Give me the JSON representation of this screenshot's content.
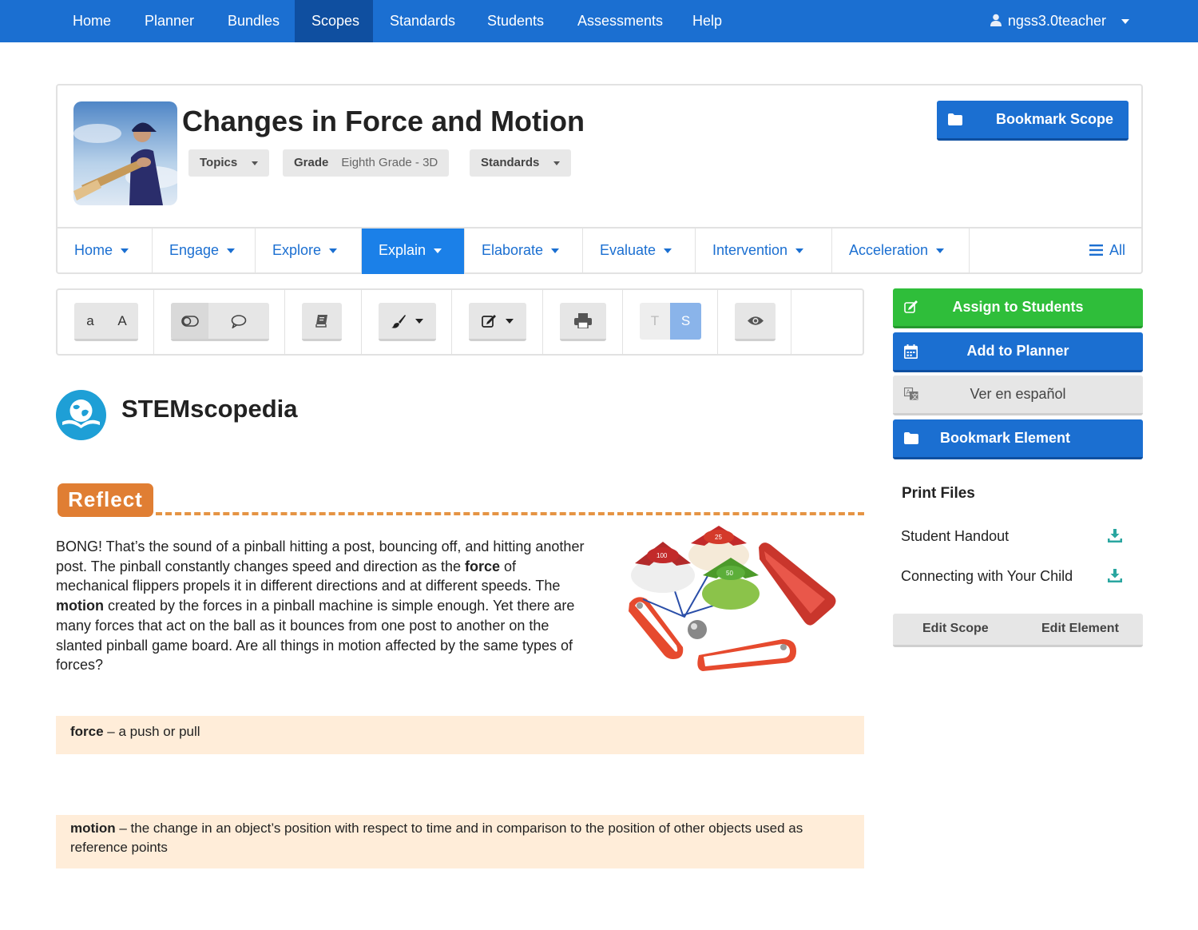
{
  "topnav": {
    "items": [
      {
        "label": "Home"
      },
      {
        "label": "Planner"
      },
      {
        "label": "Bundles"
      },
      {
        "label": "Scopes"
      },
      {
        "label": "Standards"
      },
      {
        "label": "Students"
      },
      {
        "label": "Assessments"
      },
      {
        "label": "Help"
      }
    ],
    "active": "Scopes",
    "user": "ngss3.0teacher"
  },
  "header": {
    "title": "Changes in Force and Motion",
    "topics_label": "Topics",
    "grade_label": "Grade",
    "grade_value": "Eighth Grade - 3D",
    "standards_label": "Standards",
    "bookmark_scope": "Bookmark Scope"
  },
  "tabs": {
    "items": [
      {
        "label": "Home"
      },
      {
        "label": "Engage"
      },
      {
        "label": "Explore"
      },
      {
        "label": "Explain"
      },
      {
        "label": "Elaborate"
      },
      {
        "label": "Evaluate"
      },
      {
        "label": "Intervention"
      },
      {
        "label": "Acceleration"
      }
    ],
    "active": "Explain",
    "all_label": "All"
  },
  "toolbar": {
    "font_small": "a",
    "font_large": "A",
    "teacher_toggle": "T",
    "student_toggle": "S"
  },
  "sidebar": {
    "assign": "Assign to Students",
    "planner": "Add to Planner",
    "spanish": "Ver en español",
    "bookmark_element": "Bookmark Element",
    "print_title": "Print Files",
    "files": [
      {
        "label": "Student Handout"
      },
      {
        "label": "Connecting with Your Child"
      }
    ],
    "edit_scope": "Edit Scope",
    "edit_element": "Edit Element"
  },
  "content": {
    "section_title": "STEMscopedia",
    "reflect_label": "Reflect",
    "paragraph": {
      "p1": "BONG! That’s the sound of a pinball hitting a post, bouncing off, and hitting another post. The pinball constantly changes speed and direction as the ",
      "b1": "force",
      "p2": " of mechanical flippers propels it in different directions and at different speeds. The ",
      "b2": "motion",
      "p3": " created by the forces in a pinball machine is simple enough. Yet there are many forces that act on the ball as it bounces from one post to another on the slanted pinball game board. Are all things in motion affected by the same types of forces?"
    },
    "vocab": [
      {
        "term": "force",
        "definition": " – a push or pull"
      },
      {
        "term": "motion",
        "definition": " – the change in an object’s position with respect to time and in comparison to the position of other objects used as reference points"
      }
    ],
    "bumper_values": [
      "100",
      "25",
      "50"
    ]
  },
  "colors": {
    "primary": "#1b6fd1",
    "active_tab": "#1b80e8",
    "green": "#2fbe3a",
    "reflect": "#e07e33",
    "vocab_bg": "#ffedd9"
  }
}
